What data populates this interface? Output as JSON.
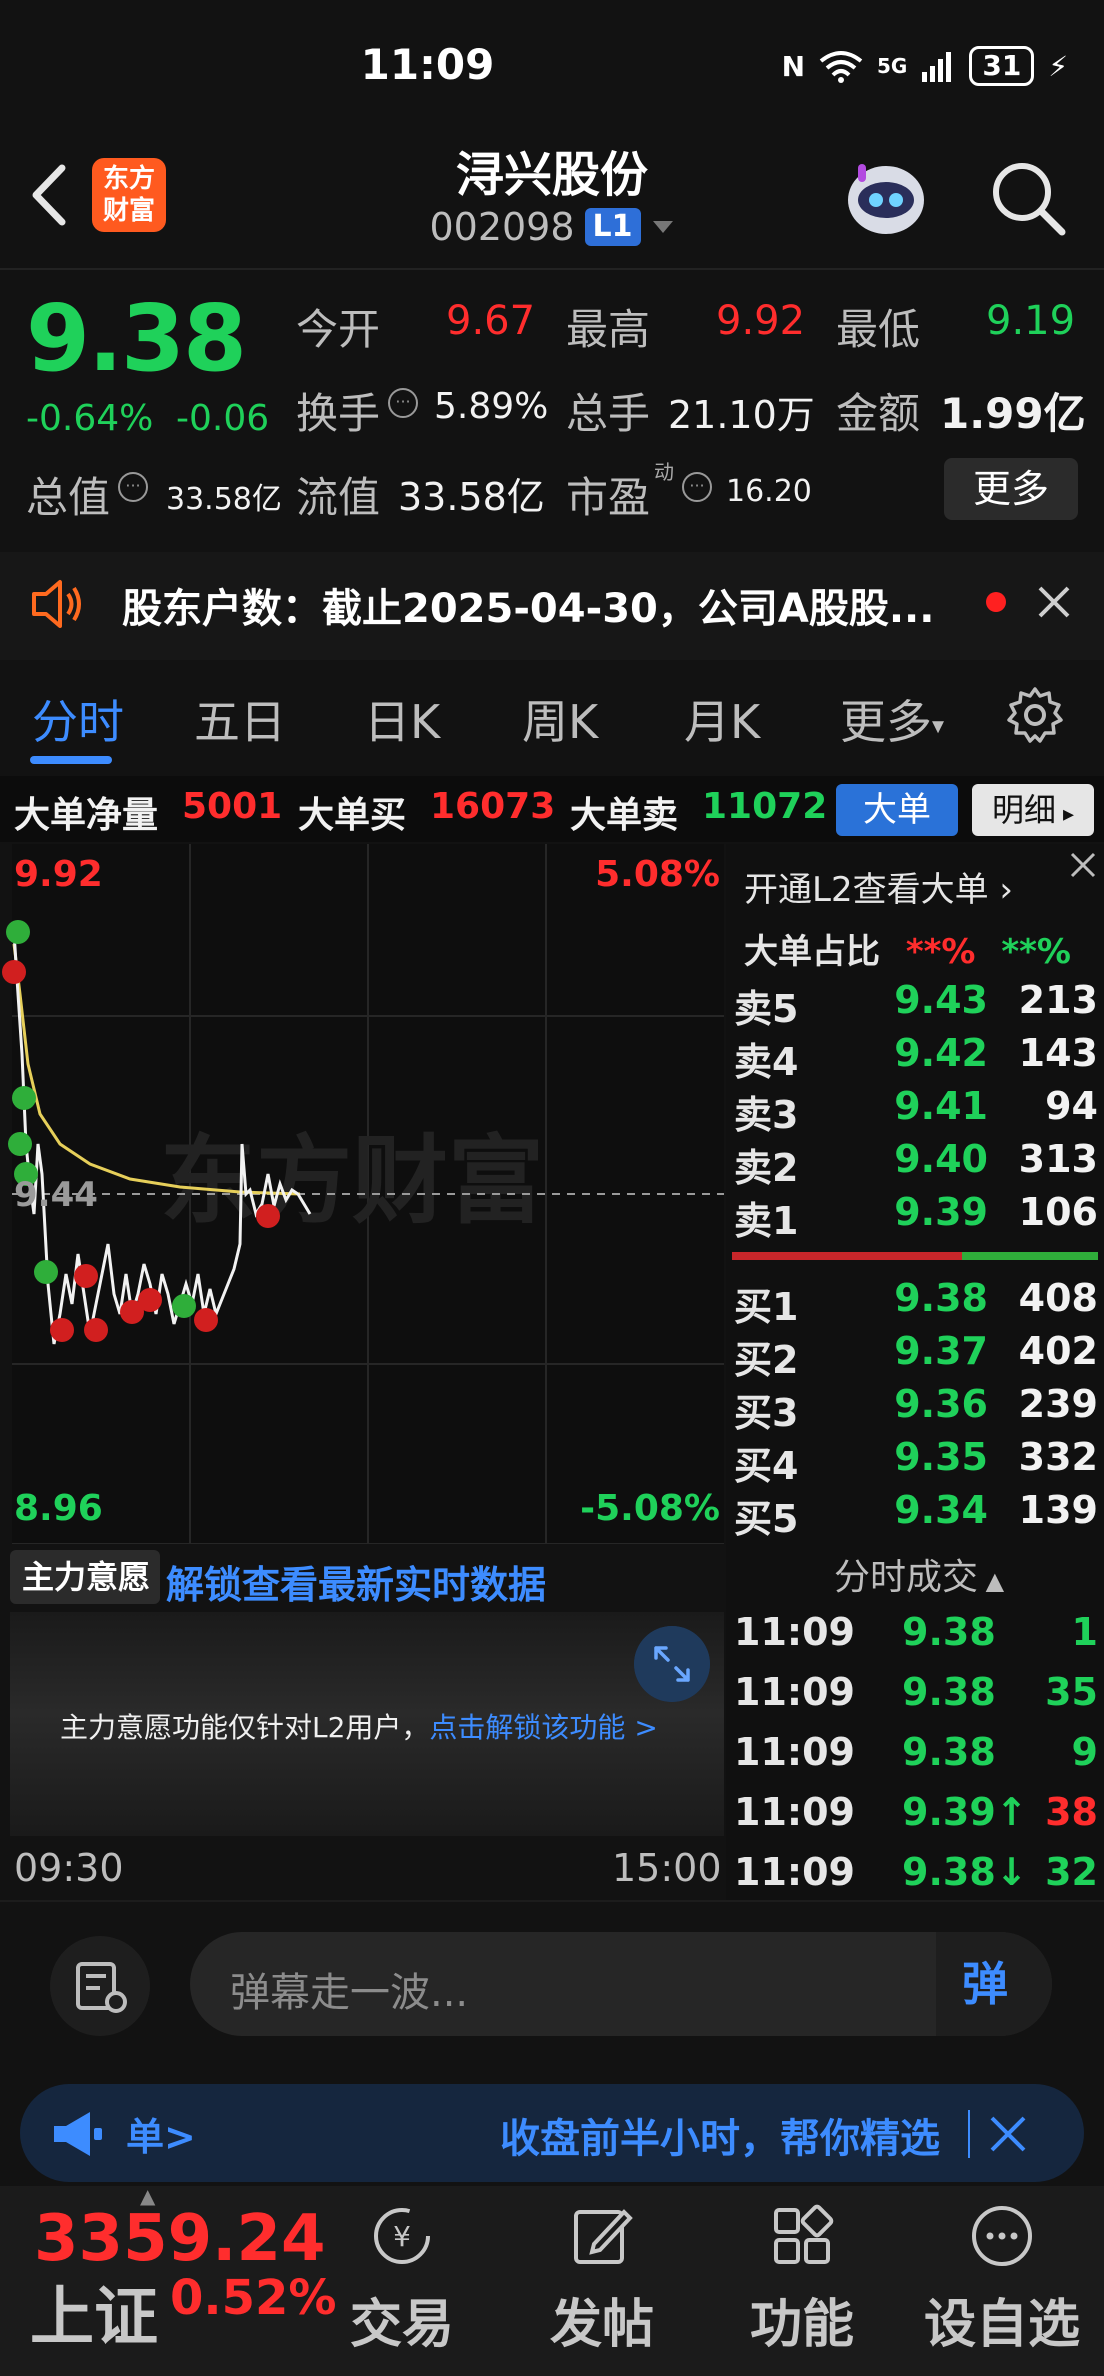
{
  "status_bar": {
    "time": "11:09",
    "network": "5G",
    "battery": "31"
  },
  "header": {
    "stock_name": "浔兴股份",
    "stock_code": "002098",
    "level_badge": "L1",
    "logo_line1": "东方",
    "logo_line2": "财富"
  },
  "quote": {
    "price": "9.38",
    "change_pct": "-0.64%",
    "change_val": "-0.06",
    "open_label": "今开",
    "open": "9.67",
    "high_label": "最高",
    "high": "9.92",
    "low_label": "最低",
    "low": "9.19",
    "turnover_label": "换手",
    "turnover": "5.89%",
    "volume_label": "总手",
    "volume": "21.10万",
    "amount_label": "金额",
    "amount": "1.99亿",
    "mcap_label": "总值",
    "mcap": "33.58亿",
    "float_label": "流值",
    "float_mcap": "33.58亿",
    "pe_label": "市盈",
    "pe_sup": "动",
    "pe": "16.20",
    "more": "更多"
  },
  "notice": {
    "text": "股东户数：截止2025-04-30，公司A股股..."
  },
  "tabs": [
    "分时",
    "五日",
    "日K",
    "周K",
    "月K",
    "更多"
  ],
  "big_order": {
    "net_label": "大单净量",
    "net": "5001",
    "buy_label": "大单买",
    "buy": "16073",
    "sell_label": "大单卖",
    "sell": "11072",
    "btn_big": "大单",
    "btn_detail": "明细"
  },
  "chart_axis": {
    "top_price": "9.92",
    "top_pct": "5.08%",
    "bottom_price": "8.96",
    "bottom_pct": "-5.08%",
    "prev_close": "9.44",
    "watermark": "东方财富"
  },
  "orderbook": {
    "l2_link": "开通L2查看大单",
    "ratio_label": "大单占比",
    "ratio_red": "**%",
    "ratio_green": "**%",
    "asks": [
      {
        "label": "卖5",
        "price": "9.43",
        "vol": "213"
      },
      {
        "label": "卖4",
        "price": "9.42",
        "vol": "143"
      },
      {
        "label": "卖3",
        "price": "9.41",
        "vol": "94"
      },
      {
        "label": "卖2",
        "price": "9.40",
        "vol": "313"
      },
      {
        "label": "卖1",
        "price": "9.39",
        "vol": "106"
      }
    ],
    "bids": [
      {
        "label": "买1",
        "price": "9.38",
        "vol": "408"
      },
      {
        "label": "买2",
        "price": "9.37",
        "vol": "402"
      },
      {
        "label": "买3",
        "price": "9.36",
        "vol": "239"
      },
      {
        "label": "买4",
        "price": "9.35",
        "vol": "332"
      },
      {
        "label": "买5",
        "price": "9.34",
        "vol": "139"
      }
    ]
  },
  "trades": {
    "title": "分时成交",
    "rows": [
      {
        "time": "11:09",
        "price": "9.38",
        "vol": "1"
      },
      {
        "time": "11:09",
        "price": "9.38",
        "vol": "35"
      },
      {
        "time": "11:09",
        "price": "9.38",
        "vol": "9"
      },
      {
        "time": "11:09",
        "price": "9.39↑",
        "vol": "38"
      },
      {
        "time": "11:09",
        "price": "9.38↓",
        "vol": "32"
      }
    ]
  },
  "intent": {
    "tag": "主力意愿",
    "unlock": "解锁查看最新实时数据",
    "msg": "主力意愿功能仅针对L2用户，",
    "msg_link": "点击解锁该功能 >"
  },
  "time_axis": {
    "start": "09:30",
    "end": "15:00"
  },
  "danmu": {
    "placeholder": "弹幕走一波...",
    "send": "弹"
  },
  "promo": {
    "left": "单>",
    "right": "收盘前半小时，帮你精选"
  },
  "bottom_nav": {
    "index_value": "3359.24",
    "index_name": "上证",
    "index_pct": "0.52%",
    "items": [
      "交易",
      "发帖",
      "功能",
      "设自选"
    ]
  },
  "colors": {
    "up": "#ff2d2d",
    "down": "#1fd15a",
    "accent": "#3d8cff"
  }
}
